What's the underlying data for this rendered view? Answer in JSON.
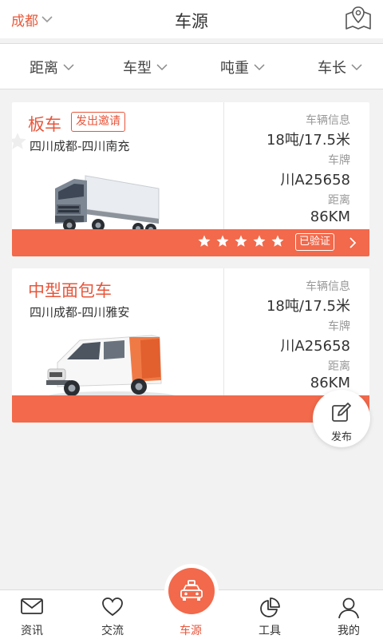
{
  "header": {
    "city": "成都",
    "title": "车源"
  },
  "filters": [
    {
      "label": "距离"
    },
    {
      "label": "车型"
    },
    {
      "label": "吨重"
    },
    {
      "label": "车长"
    }
  ],
  "cards": [
    {
      "vehicle_type": "板车",
      "invite_label": "发出邀请",
      "route": "四川成都-四川南充",
      "info_label": "车辆信息",
      "info_value": "18吨/17.5米",
      "plate_label": "车牌",
      "plate_value": "川A25658",
      "distance_label": "距离",
      "distance_value": "86KM",
      "rating": 5,
      "verified_label": "已验证"
    },
    {
      "vehicle_type": "中型面包车",
      "route": "四川成都-四川雅安",
      "info_label": "车辆信息",
      "info_value": "18吨/17.5米",
      "plate_label": "车牌",
      "plate_value": "川A25658",
      "distance_label": "距离",
      "distance_value": "86KM"
    }
  ],
  "publish": {
    "label": "发布"
  },
  "nav": [
    {
      "label": "资讯",
      "icon": "mail-icon"
    },
    {
      "label": "交流",
      "icon": "heart-icon"
    },
    {
      "label": "车源",
      "icon": "taxi-icon",
      "active": true
    },
    {
      "label": "工具",
      "icon": "pie-chart-icon"
    },
    {
      "label": "我的",
      "icon": "user-icon"
    }
  ],
  "colors": {
    "accent": "#f2694b",
    "accent_text": "#e8553a"
  }
}
